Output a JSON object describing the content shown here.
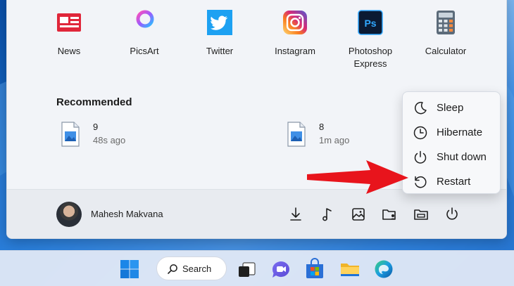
{
  "pinned_apps": [
    {
      "label": "News",
      "icon": "news-icon"
    },
    {
      "label": "PicsArt",
      "icon": "picsart-icon"
    },
    {
      "label": "Twitter",
      "icon": "twitter-icon"
    },
    {
      "label": "Instagram",
      "icon": "instagram-icon"
    },
    {
      "label": "Photoshop Express",
      "icon": "photoshop-express-icon"
    },
    {
      "label": "Calculator",
      "icon": "calculator-icon"
    }
  ],
  "recommended": {
    "title": "Recommended",
    "items": [
      {
        "name": "9",
        "time": "48s ago"
      },
      {
        "name": "8",
        "time": "1m ago"
      }
    ]
  },
  "user": {
    "name": "Mahesh Makvana"
  },
  "power_menu": {
    "items": [
      {
        "label": "Sleep",
        "icon": "moon-icon"
      },
      {
        "label": "Hibernate",
        "icon": "clock-icon"
      },
      {
        "label": "Shut down",
        "icon": "power-icon"
      },
      {
        "label": "Restart",
        "icon": "restart-icon"
      }
    ]
  },
  "taskbar": {
    "search_label": "Search"
  },
  "colors": {
    "annotation_arrow": "#e8141c",
    "accent": "#0a5fd3"
  }
}
